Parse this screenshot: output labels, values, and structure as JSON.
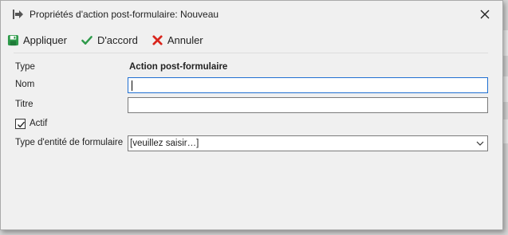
{
  "window": {
    "title": "Propriétés d'action post-formulaire: Nouveau"
  },
  "toolbar": {
    "apply_label": "Appliquer",
    "ok_label": "D'accord",
    "cancel_label": "Annuler"
  },
  "form": {
    "type_label": "Type",
    "type_value": "Action post-formulaire",
    "name_label": "Nom",
    "name_value": "",
    "title_label": "Titre",
    "title_value": "",
    "active_label": "Actif",
    "active_checked": true,
    "entity_type_label": "Type d'entité de formulaire",
    "entity_type_value": "[veuillez saisir…]"
  },
  "colors": {
    "save_icon": "#2e9a4a",
    "ok_icon": "#2e9a4a",
    "cancel_icon": "#d9251c",
    "focus_border": "#1f6fd1"
  }
}
